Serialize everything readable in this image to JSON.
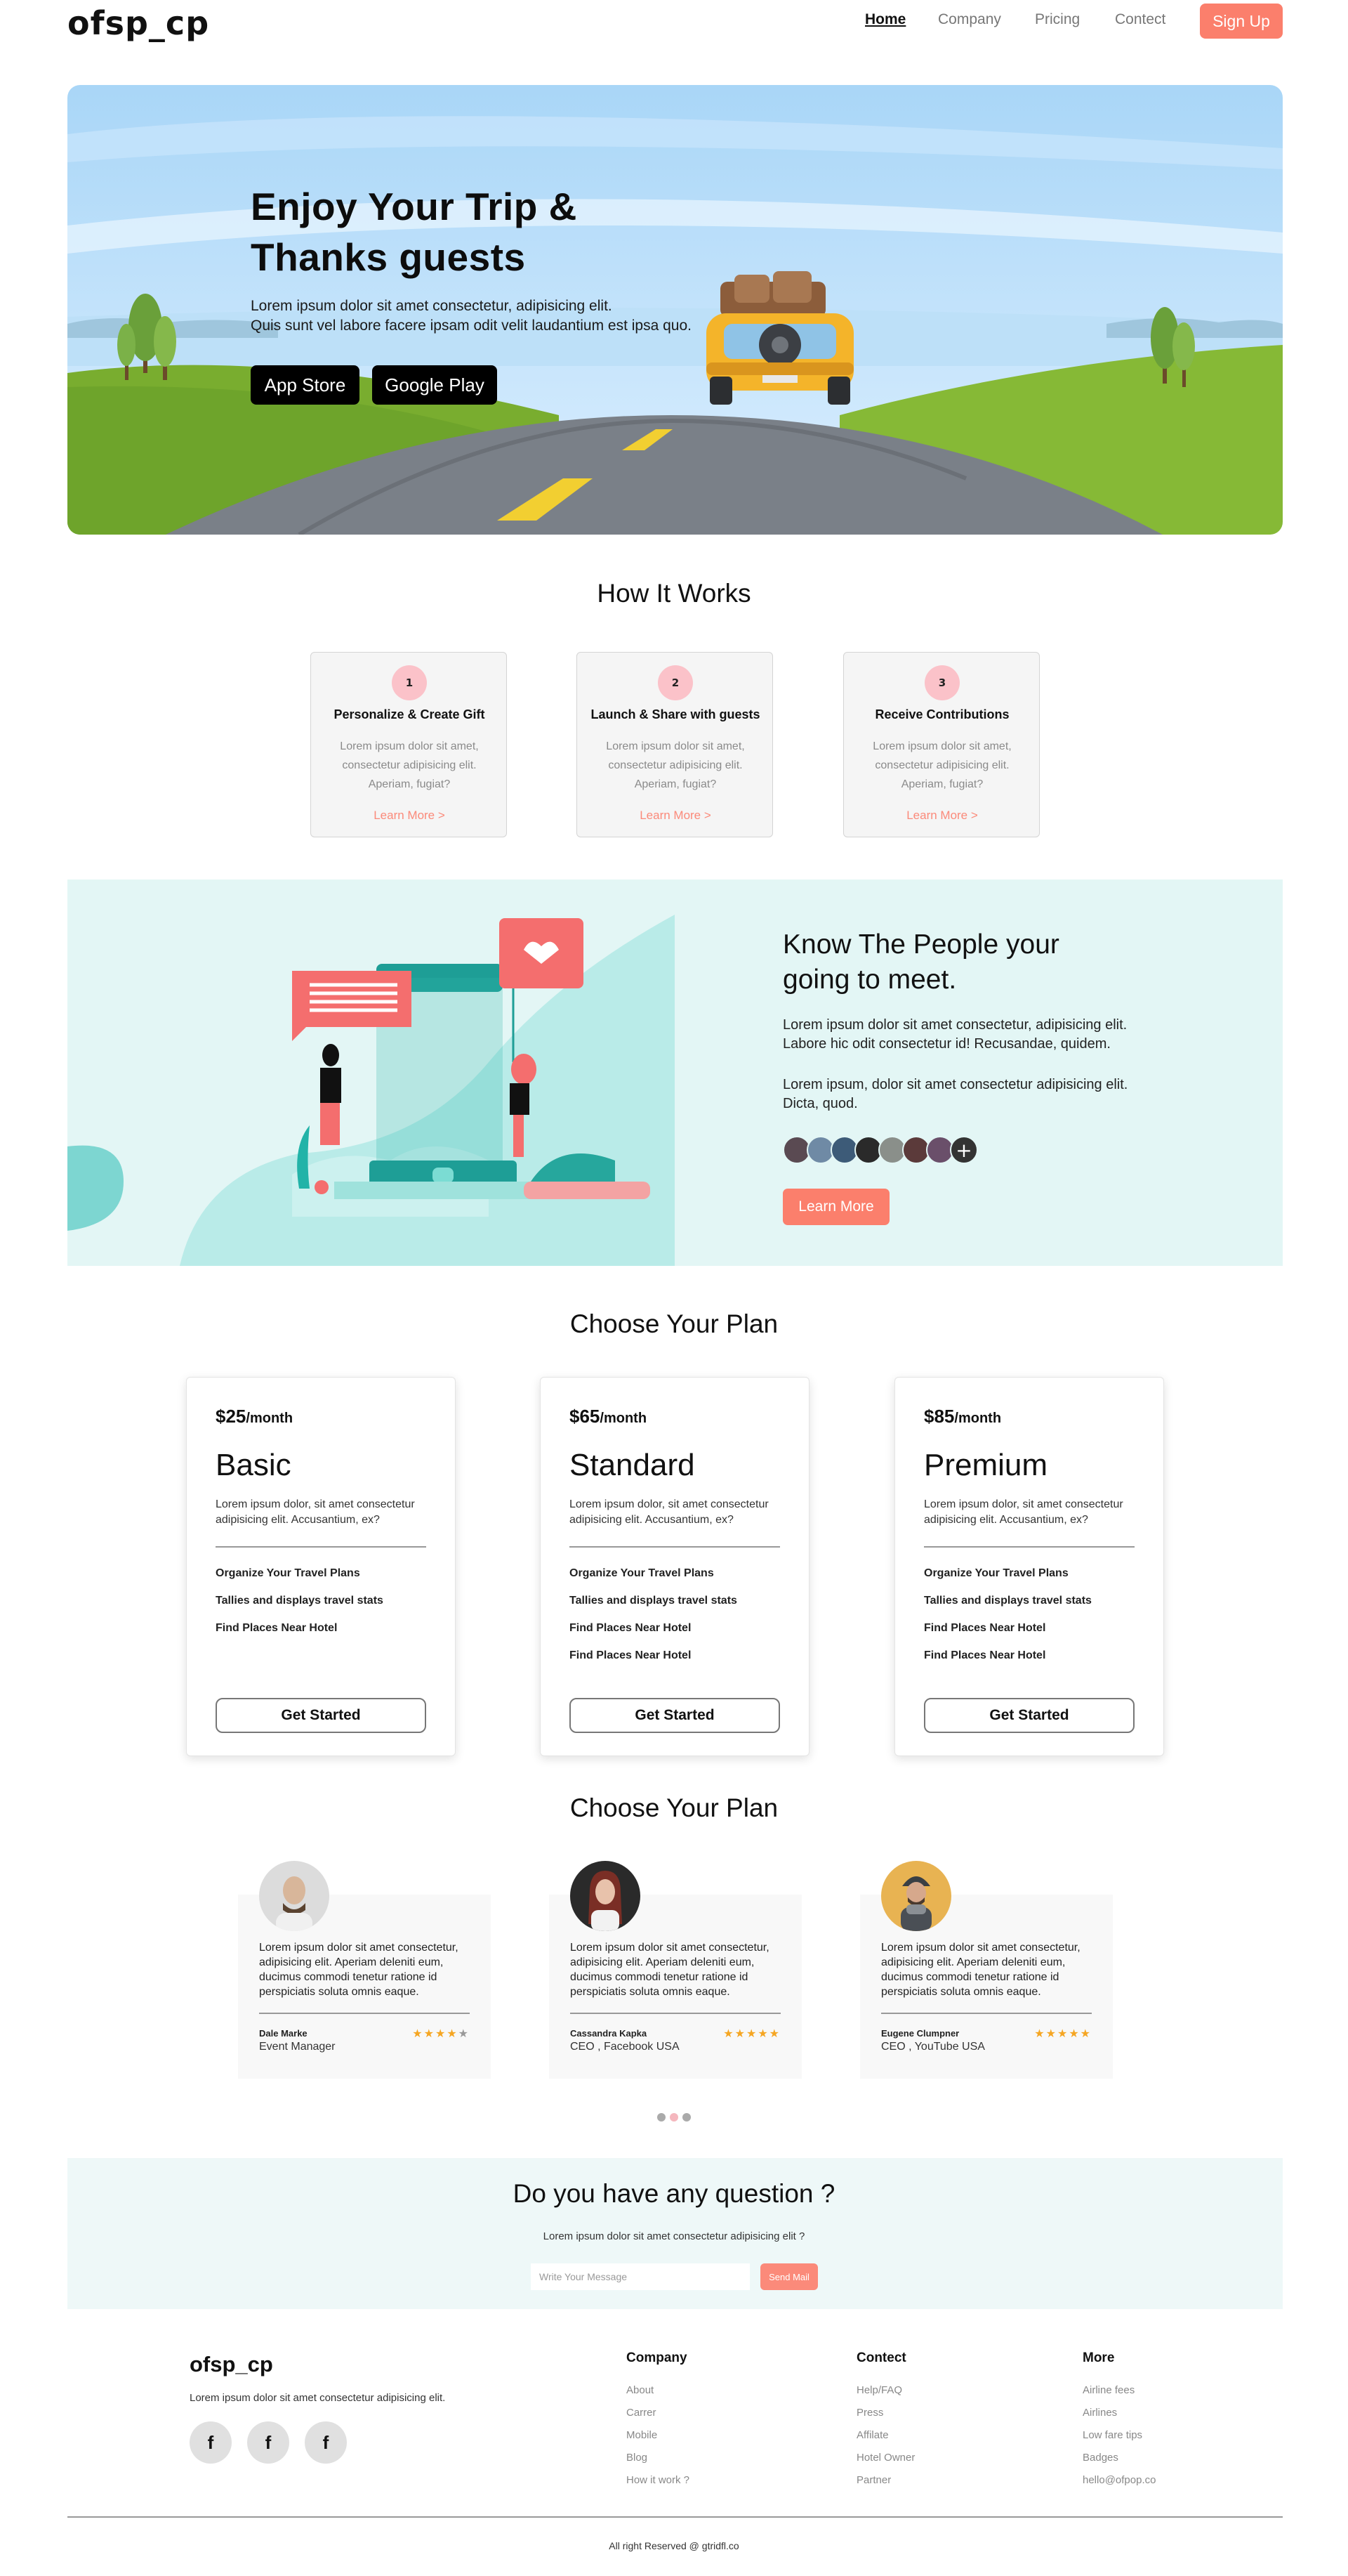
{
  "brand": {
    "logo": "ofsp_cp",
    "accent": "#fb7f6c"
  },
  "nav": {
    "items": [
      "Home",
      "Company",
      "Pricing",
      "Contect"
    ],
    "active": "Home",
    "signup": "Sign Up"
  },
  "hero": {
    "title_line1": "Enjoy Your Trip &",
    "title_line2": "Thanks guests",
    "text_line1": "Lorem ipsum dolor sit amet consectetur, adipisicing elit.",
    "text_line2": "Quis sunt vel labore facere ipsam odit velit laudantium est ipsa quo.",
    "app_store": "App Store",
    "google_play": "Google Play"
  },
  "how": {
    "title": "How It Works",
    "steps": [
      {
        "num": "1",
        "title": "Personalize & Create Gift",
        "text": "Lorem ipsum dolor sit amet, consectetur adipisicing elit. Aperiam, fugiat?",
        "link": "Learn More >"
      },
      {
        "num": "2",
        "title": "Launch & Share with guests",
        "text": "Lorem ipsum dolor sit amet, consectetur adipisicing elit. Aperiam, fugiat?",
        "link": "Learn More >"
      },
      {
        "num": "3",
        "title": "Receive Contributions",
        "text": "Lorem ipsum dolor sit amet, consectetur adipisicing elit. Aperiam, fugiat?",
        "link": "Learn More >"
      }
    ]
  },
  "people": {
    "title_line1": "Know The People your",
    "title_line2": "going to meet.",
    "para1": "Lorem ipsum dolor sit amet consectetur, adipisicing elit. Labore hic odit consectetur id! Recusandae, quidem.",
    "para2": "Lorem ipsum, dolor sit amet consectetur adipisicing elit. Dicta, quod.",
    "add_icon": "+",
    "button": "Learn More"
  },
  "plans": {
    "title": "Choose Your Plan",
    "period": "/month",
    "items": [
      {
        "price": "$25",
        "name": "Basic",
        "desc": "Lorem ipsum dolor, sit amet consectetur adipisicing elit. Accusantium, ex?",
        "features": [
          "Organize Your Travel Plans",
          "Tallies and displays travel stats",
          "Find Places Near Hotel"
        ],
        "button": "Get Started"
      },
      {
        "price": "$65",
        "name": "Standard",
        "desc": "Lorem ipsum dolor, sit amet consectetur adipisicing elit. Accusantium, ex?",
        "features": [
          "Organize Your Travel Plans",
          "Tallies and displays travel stats",
          "Find Places Near Hotel",
          "Find Places Near Hotel"
        ],
        "button": "Get Started"
      },
      {
        "price": "$85",
        "name": "Premium",
        "desc": "Lorem ipsum dolor, sit amet consectetur adipisicing elit. Accusantium, ex?",
        "features": [
          "Organize Your Travel Plans",
          "Tallies and displays travel stats",
          "Find Places Near Hotel",
          "Find Places Near Hotel"
        ],
        "button": "Get Started"
      }
    ]
  },
  "testimonials": {
    "title": "Choose Your Plan",
    "items": [
      {
        "text": "Lorem ipsum dolor sit amet consectetur, adipisicing elit. Aperiam deleniti eum, ducimus commodi tenetur ratione id perspiciatis soluta omnis eaque.",
        "name": "Dale Marke",
        "role": "Event Manager",
        "rating": 4
      },
      {
        "text": "Lorem ipsum dolor sit amet consectetur, adipisicing elit. Aperiam deleniti eum, ducimus commodi tenetur ratione id perspiciatis soluta omnis eaque.",
        "name": "Cassandra Kapka",
        "role": "CEO , Facebook USA",
        "rating": 5
      },
      {
        "text": "Lorem ipsum dolor sit amet consectetur, adipisicing elit. Aperiam deleniti eum, ducimus commodi tenetur ratione id perspiciatis soluta omnis eaque.",
        "name": "Eugene Clumpner",
        "role": "CEO , YouTube USA",
        "rating": 5
      }
    ],
    "carousel_active": 2
  },
  "question": {
    "title": "Do you have any question ?",
    "subtitle": "Lorem ipsum dolor sit amet consectetur adipisicing elit ?",
    "placeholder": "Write Your Message",
    "button": "Send Mail"
  },
  "footer": {
    "logo": "ofsp_cp",
    "tagline": "Lorem ipsum dolor sit amet consectetur adipisicing elit.",
    "social_icon": "f",
    "columns": [
      {
        "title": "Company",
        "links": [
          "About",
          "Carrer",
          "Mobile",
          "Blog",
          "How it work ?"
        ]
      },
      {
        "title": "Contect",
        "links": [
          "Help/FAQ",
          "Press",
          "Affilate",
          "Hotel Owner",
          "Partner"
        ]
      },
      {
        "title": "More",
        "links": [
          "Airline fees",
          "Airlines",
          "Low fare tips",
          "Badges",
          "hello@ofpop.co"
        ]
      }
    ],
    "copyright": "All right Reserved @ gtridfl.co"
  }
}
